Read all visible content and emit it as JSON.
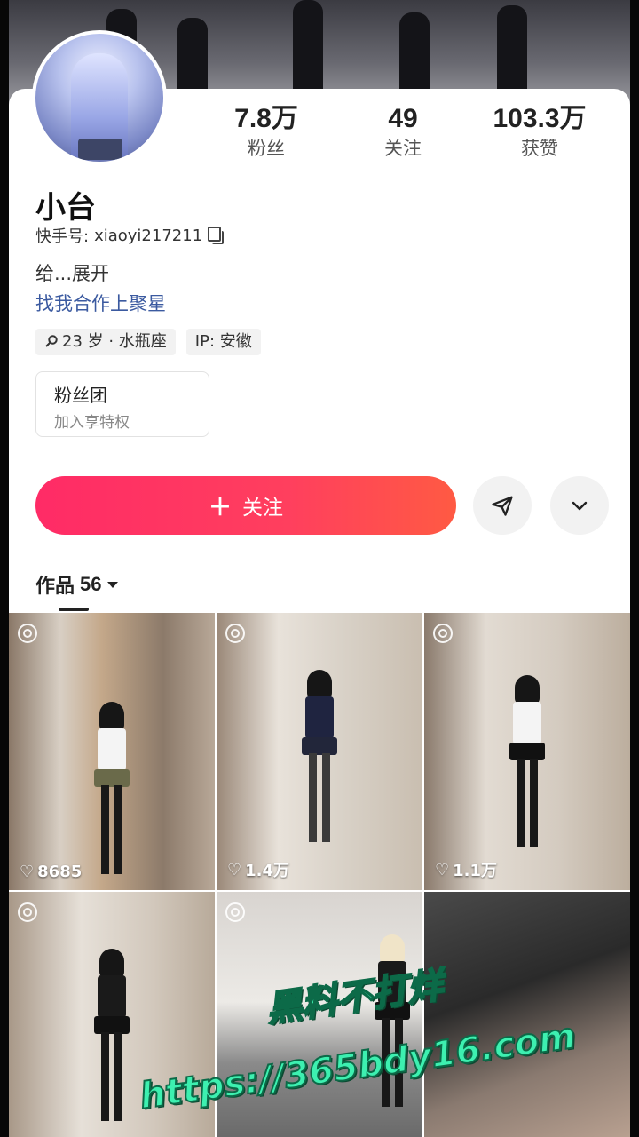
{
  "profile": {
    "name": "小台",
    "uid_label": "快手号:",
    "uid": "xiaoyi217211",
    "bio": "给...展开",
    "link": "找我合作上聚星",
    "tags": [
      {
        "icon": "search-icon",
        "text": "23 岁 · 水瓶座"
      },
      {
        "text": "IP: 安徽"
      }
    ]
  },
  "stats": [
    {
      "value": "7.8万",
      "label": "粉丝"
    },
    {
      "value": "49",
      "label": "关注"
    },
    {
      "value": "103.3万",
      "label": "获赞"
    }
  ],
  "fan_club": {
    "title": "粉丝团",
    "subtitle": "加入享特权"
  },
  "actions": {
    "follow_icon": "plus-icon",
    "follow_label": "关注",
    "share_icon": "send-icon",
    "more_icon": "chevron-down-icon"
  },
  "tabs": [
    {
      "label": "作品",
      "count": "56"
    }
  ],
  "posts": [
    {
      "likes": "8685",
      "live": true
    },
    {
      "likes": "1.4万",
      "live": true
    },
    {
      "likes": "1.1万",
      "live": true
    },
    {
      "likes": "",
      "live": true
    },
    {
      "likes": "",
      "live": true
    },
    {
      "likes": "",
      "live": false
    }
  ],
  "watermark": {
    "line1": "黑料不打烊",
    "line2": "https://365bdy16.com",
    "color": "#3df0b0"
  }
}
